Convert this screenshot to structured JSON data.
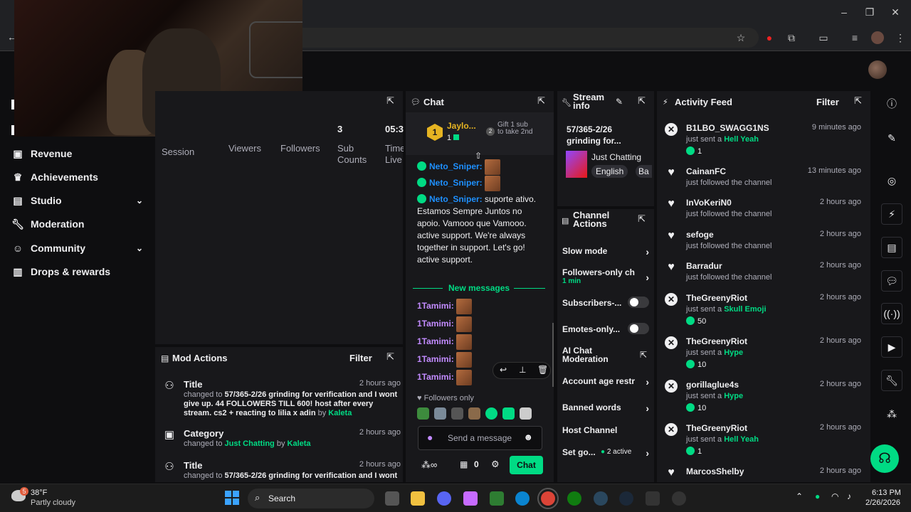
{
  "nav": {
    "items": [
      {
        "label": "Revenue"
      },
      {
        "label": "Achievements"
      },
      {
        "label": "Studio"
      },
      {
        "label": "Moderation"
      },
      {
        "label": "Community"
      },
      {
        "label": "Drops & rewards"
      }
    ]
  },
  "stats": {
    "labels": [
      "Session",
      "Viewers",
      "Followers",
      "Sub Counts",
      "Time Live"
    ],
    "values": {
      "subs": "3",
      "time": "05:3"
    }
  },
  "mod_actions": {
    "title": "Mod Actions",
    "filter": "Filter",
    "entries": [
      {
        "title": "Title",
        "time": "2 hours ago",
        "prefix": "changed to ",
        "value": "57/365-2/26 grinding for verification and I wont give up. 44 FOLLOWERS TILL 600! host after every stream. cs2 + reacting to lilia x adin",
        "by": " by ",
        "user": "Kaleta"
      },
      {
        "title": "Category",
        "time": "2 hours ago",
        "prefix": "changed to ",
        "value": "Just Chatting",
        "by": " by ",
        "user": "Kaleta"
      },
      {
        "title": "Title",
        "time": "2 hours ago",
        "prefix": "changed to ",
        "value": "57/365-2/26 grinding for verification and I wont"
      }
    ]
  },
  "chat": {
    "title": "Chat",
    "leader_name": "Jaylo...",
    "leader_count": "1",
    "gift_text": "Gift 1 sub to take 2nd",
    "lines": [
      {
        "user": "Neto_Sniper:"
      },
      {
        "user": "Neto_Sniper:"
      },
      {
        "user": "Neto_Sniper:",
        "text": " suporte ativo.  Estamos Sempre Juntos no  apoio. Vamooo que Vamooo.  active support.  We're always together in  support. Let's go!  active support."
      }
    ],
    "new_messages": "New messages",
    "tamimi": [
      "1Tamimi:",
      "1Tamimi:",
      "1Tamimi:",
      "1Tamimi:",
      "1Tamimi:"
    ],
    "followers_only": "Followers only",
    "input_placeholder": "Send a message",
    "points": "0",
    "send_label": "Chat"
  },
  "stream_info": {
    "title": "Stream info",
    "stream_title": "57/365-2/26 grinding for...",
    "category": "Just Chatting",
    "tag1": "English",
    "tag2": "Ba"
  },
  "channel_actions": {
    "title": "Channel Actions",
    "slow_mode": "Slow mode",
    "followers_only": "Followers-only ch",
    "followers_only_sub": "1 min",
    "subscribers": "Subscribers-...",
    "emotes": "Emotes-only...",
    "ai_chat": "AI Chat Moderation",
    "account_age": "Account age restr",
    "banned_words": "Banned words",
    "host_channel": "Host Channel",
    "set_goal": "Set go...",
    "active_count": "2 active"
  },
  "activity_feed": {
    "title": "Activity Feed",
    "filter": "Filter",
    "items": [
      {
        "name": "B1LBO_SWAGG1NS",
        "time": "9 minutes ago",
        "action": "just sent a ",
        "item": "Hell Yeah",
        "amount": "1",
        "type": "bits"
      },
      {
        "name": "CainanFC",
        "time": "13 minutes ago",
        "action": "just followed the channel",
        "type": "follow"
      },
      {
        "name": "InVoKeriN0",
        "time": "2 hours ago",
        "action": "just followed the channel",
        "type": "follow"
      },
      {
        "name": "sefoge",
        "time": "2 hours ago",
        "action": "just followed the channel",
        "type": "follow"
      },
      {
        "name": "Barradur",
        "time": "2 hours ago",
        "action": "just followed the channel",
        "type": "follow"
      },
      {
        "name": "TheGreenyRiot",
        "time": "2 hours ago",
        "action": "just sent a ",
        "item": "Skull Emoji",
        "amount": "50",
        "type": "bits"
      },
      {
        "name": "TheGreenyRiot",
        "time": "2 hours ago",
        "action": "just sent a ",
        "item": "Hype",
        "amount": "10",
        "type": "bits"
      },
      {
        "name": "gorillaglue4s",
        "time": "2 hours ago",
        "action": "just sent a ",
        "item": "Hype",
        "amount": "10",
        "type": "bits"
      },
      {
        "name": "TheGreenyRiot",
        "time": "2 hours ago",
        "action": "just sent a ",
        "item": "Hell Yeah",
        "amount": "1",
        "type": "bits"
      },
      {
        "name": "MarcosShelby",
        "time": "2 hours ago",
        "type": "follow"
      }
    ]
  },
  "taskbar": {
    "weather_temp": "38°F",
    "weather_desc": "Partly cloudy",
    "weather_badge": "5",
    "search": "Search",
    "time": "6:13 PM",
    "date": "2/26/2026"
  },
  "colors": {
    "accent": "#00db84",
    "background": "#0e0e10",
    "panel": "#18181b"
  }
}
